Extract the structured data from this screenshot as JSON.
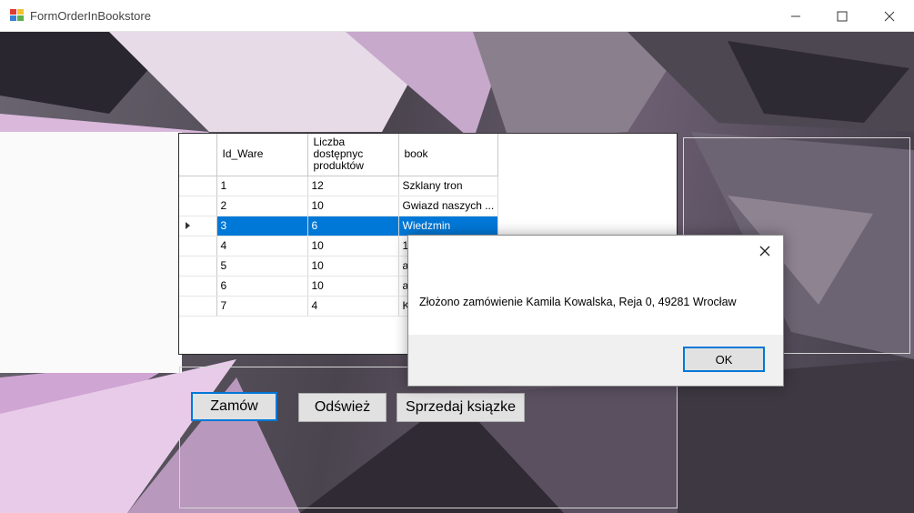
{
  "window": {
    "title": "FormOrderInBookstore",
    "icon": "app-form-icon",
    "controls": {
      "minimize": "minimize-icon",
      "maximize": "maximize-icon",
      "close": "close-icon"
    }
  },
  "grid": {
    "columns": [
      "Id_Ware",
      "Liczba dostępnyc produktów",
      "book"
    ],
    "rows": [
      {
        "id": "1",
        "count": "12",
        "book": "Szklany tron"
      },
      {
        "id": "2",
        "count": "10",
        "book": "Gwiazd naszych ..."
      },
      {
        "id": "3",
        "count": "6",
        "book": "Wiedzmin",
        "selected": true
      },
      {
        "id": "4",
        "count": "10",
        "book": "10"
      },
      {
        "id": "5",
        "count": "10",
        "book": "al"
      },
      {
        "id": "6",
        "count": "10",
        "book": "al"
      },
      {
        "id": "7",
        "count": "4",
        "book": "K"
      }
    ],
    "selection_color": "#0078d7"
  },
  "buttons": {
    "order": "Zamów",
    "refresh": "Odśwież",
    "sell": "Sprzedaj ksiązke"
  },
  "dialog": {
    "message": "Złożono zamówienie Kamila Kowalska, Reja  0, 49281 Wrocław",
    "ok_label": "OK"
  }
}
